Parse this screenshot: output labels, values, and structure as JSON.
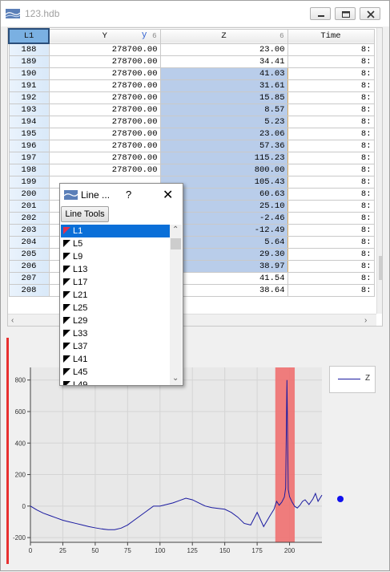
{
  "window": {
    "title": "123.hdb",
    "icon": "hdb-file-icon",
    "controls": [
      "minimize-icon",
      "maximize-icon",
      "close-icon"
    ]
  },
  "table": {
    "columns": [
      {
        "label": "L1",
        "index": ""
      },
      {
        "label": "Y",
        "index": "6",
        "marker": "y"
      },
      {
        "label": "Z",
        "index": "6"
      },
      {
        "label": "Time",
        "index": ""
      }
    ],
    "rows": [
      {
        "n": "188",
        "y": "278700.00",
        "z": "23.00",
        "t": "8:"
      },
      {
        "n": "189",
        "y": "278700.00",
        "z": "34.41",
        "t": "8:"
      },
      {
        "n": "190",
        "y": "278700.00",
        "z": "41.03",
        "t": "8:"
      },
      {
        "n": "191",
        "y": "278700.00",
        "z": "31.61",
        "t": "8:"
      },
      {
        "n": "192",
        "y": "278700.00",
        "z": "15.85",
        "t": "8:"
      },
      {
        "n": "193",
        "y": "278700.00",
        "z": "8.57",
        "t": "8:"
      },
      {
        "n": "194",
        "y": "278700.00",
        "z": "5.23",
        "t": "8:"
      },
      {
        "n": "195",
        "y": "278700.00",
        "z": "23.06",
        "t": "8:"
      },
      {
        "n": "196",
        "y": "278700.00",
        "z": "57.36",
        "t": "8:"
      },
      {
        "n": "197",
        "y": "278700.00",
        "z": "115.23",
        "t": "8:"
      },
      {
        "n": "198",
        "y": "278700.00",
        "z": "800.00",
        "t": "8:"
      },
      {
        "n": "199",
        "y": "",
        "z": "105.43",
        "t": "8:"
      },
      {
        "n": "200",
        "y": "",
        "z": "60.63",
        "t": "8:"
      },
      {
        "n": "201",
        "y": "",
        "z": "25.10",
        "t": "8:"
      },
      {
        "n": "202",
        "y": "",
        "z": "-2.46",
        "t": "8:"
      },
      {
        "n": "203",
        "y": "",
        "z": "-12.49",
        "t": "8:"
      },
      {
        "n": "204",
        "y": "",
        "z": "5.64",
        "t": "8:"
      },
      {
        "n": "205",
        "y": "",
        "z": "29.30",
        "t": "8:"
      },
      {
        "n": "206",
        "y": "",
        "z": "38.97",
        "t": "8:"
      },
      {
        "n": "207",
        "y": "",
        "z": "41.54",
        "t": "8:"
      },
      {
        "n": "208",
        "y": "",
        "z": "38.64",
        "t": "8:"
      }
    ],
    "selected_z_range": [
      "190",
      "206"
    ]
  },
  "line_popup": {
    "title": "Line ...",
    "help": "?",
    "close": "✕",
    "tools_button": "Line Tools",
    "items": [
      "L1",
      "L5",
      "L9",
      "L13",
      "L17",
      "L21",
      "L25",
      "L29",
      "L33",
      "L37",
      "L41",
      "L45",
      "L49"
    ],
    "selected": "L1"
  },
  "chart_data": {
    "type": "line",
    "series": [
      {
        "name": "Z",
        "color": "#1a1aa0",
        "x": [
          0,
          5,
          10,
          15,
          20,
          25,
          30,
          35,
          40,
          45,
          50,
          55,
          60,
          65,
          70,
          75,
          80,
          85,
          90,
          95,
          100,
          105,
          110,
          115,
          120,
          125,
          130,
          135,
          140,
          145,
          150,
          155,
          160,
          165,
          170,
          175,
          180,
          185,
          188,
          190,
          192,
          194,
          196,
          197,
          198,
          199,
          200,
          202,
          204,
          206,
          208,
          210,
          212,
          215,
          218,
          220,
          222,
          225
        ],
        "y": [
          0,
          -25,
          -45,
          -60,
          -75,
          -90,
          -100,
          -110,
          -120,
          -130,
          -138,
          -145,
          -150,
          -150,
          -140,
          -120,
          -90,
          -60,
          -30,
          0,
          0,
          10,
          20,
          35,
          50,
          40,
          20,
          0,
          -10,
          -15,
          -20,
          -40,
          -70,
          -110,
          -120,
          -40,
          -130,
          -60,
          -20,
          30,
          5,
          25,
          57,
          115,
          800,
          105,
          60,
          25,
          -2,
          -12,
          5,
          30,
          40,
          10,
          45,
          80,
          30,
          70
        ]
      }
    ],
    "xlim": [
      0,
      225
    ],
    "ylim": [
      -230,
      880
    ],
    "xticks": [
      0,
      25,
      50,
      75,
      100,
      125,
      150,
      175,
      200
    ],
    "yticks": [
      -200,
      0,
      200,
      400,
      600,
      800
    ],
    "highlight_x_range": [
      189,
      204
    ],
    "highlight_color": "#f07070",
    "legend": {
      "label": "Z",
      "position": "top-right"
    },
    "grid": true
  }
}
